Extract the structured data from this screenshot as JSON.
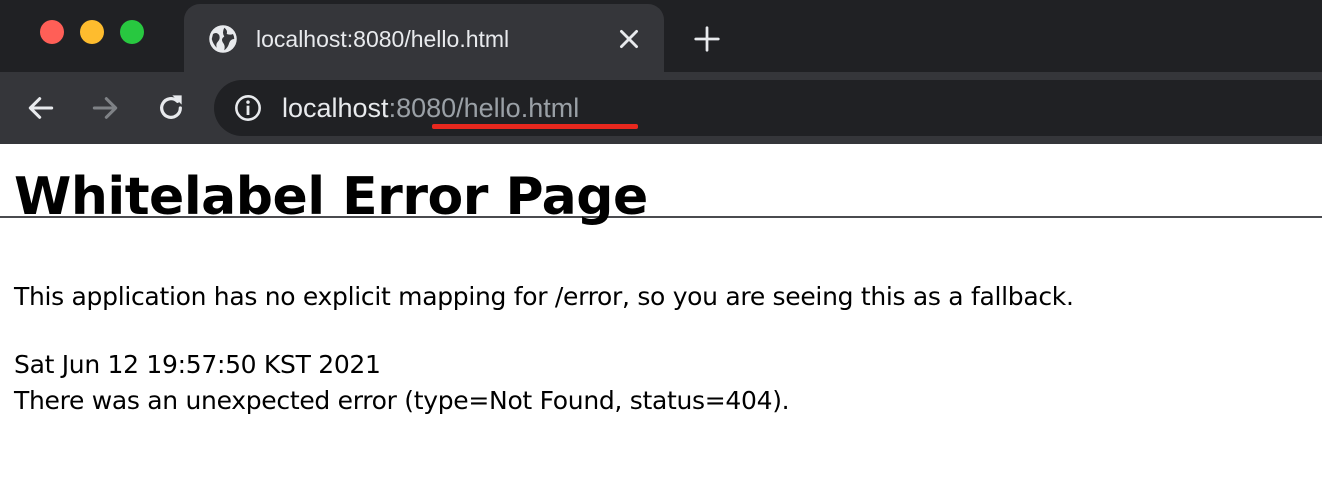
{
  "window": {
    "controls": [
      "close",
      "minimize",
      "maximize"
    ],
    "colors": {
      "close": "#ff5f57",
      "minimize": "#febc2e",
      "maximize": "#28c840"
    }
  },
  "tab": {
    "title": "localhost:8080/hello.html",
    "icon": "globe-icon",
    "close_icon": "close-icon"
  },
  "new_tab_icon": "plus-icon",
  "toolbar": {
    "back_icon": "arrow-left-icon",
    "forward_icon": "arrow-right-icon",
    "reload_icon": "reload-icon",
    "info_icon": "info-icon",
    "url_host": "localhost",
    "url_rest": ":8080/hello.html",
    "url_annotation_color": "#e8281e"
  },
  "page": {
    "heading": "Whitelabel Error Page",
    "message": "This application has no explicit mapping for /error, so you are seeing this as a fallback.",
    "timestamp": "Sat Jun 12 19:57:50 KST 2021",
    "error_detail": "There was an unexpected error (type=Not Found, status=404)."
  }
}
